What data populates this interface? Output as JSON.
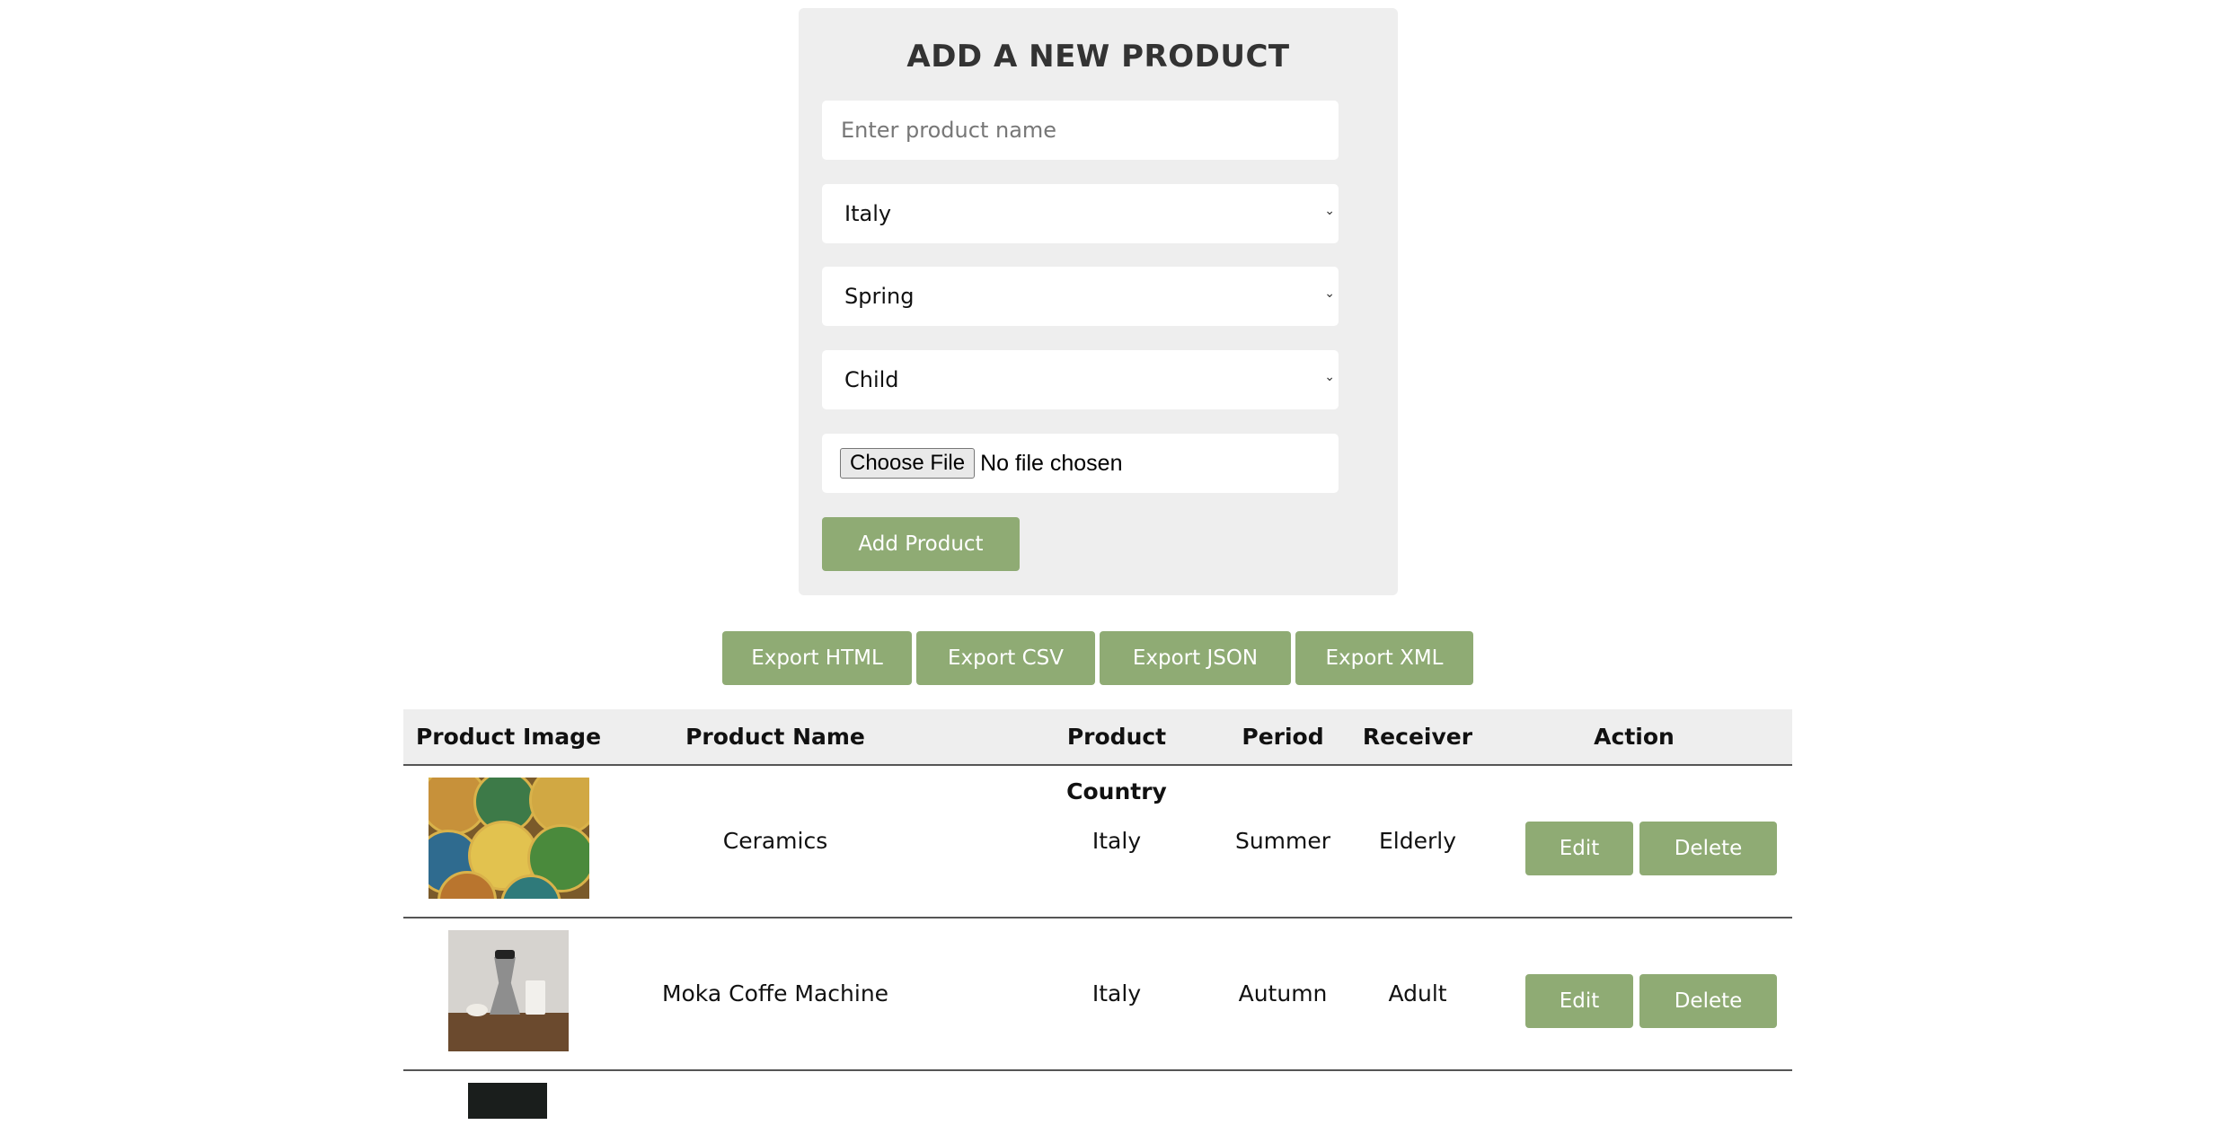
{
  "form": {
    "title": "ADD A NEW PRODUCT",
    "name_placeholder": "Enter product name",
    "country_selected": "Italy",
    "period_selected": "Spring",
    "receiver_selected": "Child",
    "file_button_label": "Choose File",
    "file_status": "No file chosen",
    "submit_label": "Add Product"
  },
  "export_buttons": {
    "html": "Export HTML",
    "csv": "Export CSV",
    "json": "Export JSON",
    "xml": "Export XML"
  },
  "table": {
    "headers": {
      "image": "Product Image",
      "name": "Product Name",
      "country": "Product Country",
      "period": "Period",
      "receiver": "Receiver",
      "action": "Action"
    },
    "rows": [
      {
        "name": "Ceramics",
        "country": "Italy",
        "period": "Summer",
        "receiver": "Elderly",
        "edit": "Edit",
        "delete": "Delete"
      },
      {
        "name": "Moka Coffe Machine",
        "country": "Italy",
        "period": "Autumn",
        "receiver": "Adult",
        "edit": "Edit",
        "delete": "Delete"
      }
    ]
  },
  "colors": {
    "accent": "#8fab74",
    "panel": "#eeeeee"
  }
}
